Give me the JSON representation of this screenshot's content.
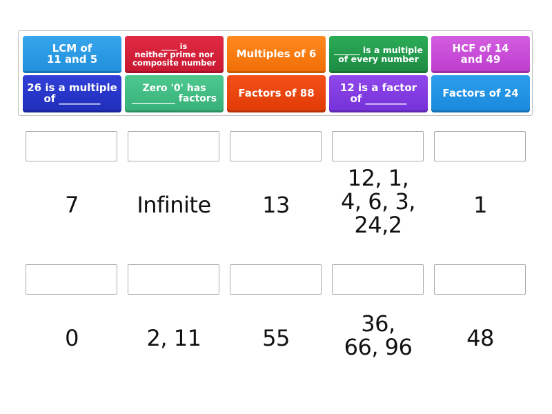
{
  "tiles": [
    {
      "lines": [
        "LCM of",
        "11 and 5"
      ],
      "color": "#2b9ae6"
    },
    {
      "lines": [
        "____ is",
        "neither prime nor",
        "composite number"
      ],
      "color": "#d42038"
    },
    {
      "lines": [
        "Multiples of 6"
      ],
      "color": "#f97c12"
    },
    {
      "lines": [
        "______ is a multiple",
        "of every number"
      ],
      "color": "#249a4d"
    },
    {
      "lines": [
        "HCF of 14",
        "and 49"
      ],
      "color": "#c84dd7"
    },
    {
      "lines": [
        "26 is a multiple",
        "of ________"
      ],
      "color": "#2736c9"
    },
    {
      "lines": [
        "Zero '0' has",
        "_________ factors"
      ],
      "color": "#41bd83"
    },
    {
      "lines": [
        "Factors of 88"
      ],
      "color": "#ea450f"
    },
    {
      "lines": [
        "12 is a factor",
        "of ________"
      ],
      "color": "#823ce1"
    },
    {
      "lines": [
        "Factors of 24"
      ],
      "color": "#2394e4"
    }
  ],
  "answers_row1": [
    {
      "lines": [
        "7"
      ]
    },
    {
      "lines": [
        "Infinite"
      ]
    },
    {
      "lines": [
        "13"
      ]
    },
    {
      "lines": [
        "12, 1,",
        "4, 6, 3,",
        "24,2"
      ]
    },
    {
      "lines": [
        "1"
      ]
    }
  ],
  "answers_row2": [
    {
      "lines": [
        "0"
      ]
    },
    {
      "lines": [
        "2, 11"
      ]
    },
    {
      "lines": [
        "55"
      ]
    },
    {
      "lines": [
        "36,",
        "66, 96"
      ]
    },
    {
      "lines": [
        "48"
      ]
    }
  ]
}
